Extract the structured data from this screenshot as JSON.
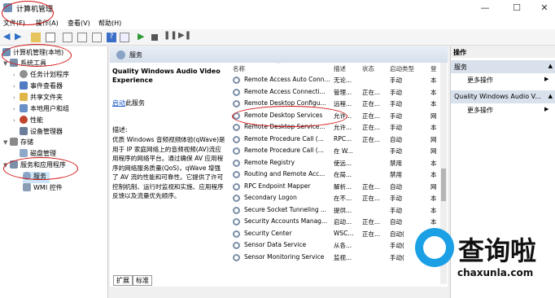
{
  "window": {
    "title": "计算机管理",
    "min_glyph": "—",
    "max_glyph": "☐",
    "close_glyph": "✕"
  },
  "menu": [
    "文件(F)",
    "操作(A)",
    "查看(V)",
    "帮助(H)"
  ],
  "tree": [
    {
      "label": "计算机管理(本地)",
      "icon": "computer-icon",
      "color": "#6f8fb3",
      "arrow": ""
    },
    {
      "label": "系统工具",
      "icon": "tools-icon",
      "color": "#7a8fa8",
      "arrow": "▼"
    },
    {
      "label": "任务计划程序",
      "icon": "clock-icon",
      "color": "#8f8f8f",
      "arrow": "›"
    },
    {
      "label": "事件查看器",
      "icon": "event-viewer-icon",
      "color": "#4f7cc2",
      "arrow": "›"
    },
    {
      "label": "共享文件夹",
      "icon": "shared-folder-icon",
      "color": "#e0b64a",
      "arrow": "›"
    },
    {
      "label": "本地用户和组",
      "icon": "users-icon",
      "color": "#6a8fc7",
      "arrow": "›"
    },
    {
      "label": "性能",
      "icon": "performance-icon",
      "color": "#c0452d",
      "arrow": "›"
    },
    {
      "label": "设备管理器",
      "icon": "device-manager-icon",
      "color": "#6a7d9a",
      "arrow": ""
    },
    {
      "label": "存储",
      "icon": "storage-icon",
      "color": "#8a8a8a",
      "arrow": "▼"
    },
    {
      "label": "磁盘管理",
      "icon": "disk-icon",
      "color": "#8fa9c9",
      "arrow": ""
    },
    {
      "label": "服务和应用程序",
      "icon": "services-apps-icon",
      "color": "#7c8fa8",
      "arrow": "▼"
    },
    {
      "label": "服务",
      "icon": "services-icon",
      "color": "#8aa3c4",
      "arrow": ""
    },
    {
      "label": "WMI 控件",
      "icon": "wmi-icon",
      "color": "#8a9db5",
      "arrow": ""
    }
  ],
  "center": {
    "header": "服务",
    "selected_service_name": "Quality Windows Audio Video Experience",
    "start_link": "启动",
    "start_suffix": "此服务",
    "desc_label": "描述:",
    "desc_text": "优质 Windows 音频视频体验(qWave)是用于 IP 家庭网络上的音频视频(AV)流应用程序的网络平台。通过确保 AV 应用程序的网络服务质量(QoS)，qWave 增强了 AV 流的性能和可靠性。它提供了许可控制机制、运行时监视和实施、应用程序反馈以及流量优先顺序。",
    "columns": {
      "name": "名称",
      "desc": "描述",
      "status": "状态",
      "startup": "启动类型",
      "logon": "登"
    },
    "services": [
      {
        "name": "Remote Access Auto Conn...",
        "desc": "无论...",
        "status": "",
        "startup": "手动",
        "logon": "本"
      },
      {
        "name": "Remote Access Connecti...",
        "desc": "管理...",
        "status": "正在...",
        "startup": "手动",
        "logon": "本"
      },
      {
        "name": "Remote Desktop Configu...",
        "desc": "远程...",
        "status": "正在...",
        "startup": "手动",
        "logon": "本"
      },
      {
        "name": "Remote Desktop Services",
        "desc": "允许...",
        "status": "正在...",
        "startup": "手动",
        "logon": "网"
      },
      {
        "name": "Remote Desktop Service...",
        "desc": "允许...",
        "status": "正在...",
        "startup": "手动",
        "logon": "本"
      },
      {
        "name": "Remote Procedure Call (...",
        "desc": "RPC...",
        "status": "正在...",
        "startup": "自动",
        "logon": "网"
      },
      {
        "name": "Remote Procedure Call (...",
        "desc": "在 W...",
        "status": "",
        "startup": "手动",
        "logon": "网"
      },
      {
        "name": "Remote Registry",
        "desc": "使远...",
        "status": "",
        "startup": "禁用",
        "logon": "本"
      },
      {
        "name": "Routing and Remote Acc...",
        "desc": "在局...",
        "status": "",
        "startup": "禁用",
        "logon": "本"
      },
      {
        "name": "RPC Endpoint Mapper",
        "desc": "解析...",
        "status": "正在...",
        "startup": "自动",
        "logon": "网"
      },
      {
        "name": "Secondary Logon",
        "desc": "在不...",
        "status": "正在...",
        "startup": "手动",
        "logon": "本"
      },
      {
        "name": "Secure Socket Tunneling ...",
        "desc": "提供...",
        "status": "",
        "startup": "手动",
        "logon": "本"
      },
      {
        "name": "Security Accounts Manag...",
        "desc": "启动...",
        "status": "正在...",
        "startup": "自动",
        "logon": "本"
      },
      {
        "name": "Security Center",
        "desc": "WSC...",
        "status": "正在...",
        "startup": "自动(",
        "logon": "本"
      },
      {
        "name": "Sensor Data Service",
        "desc": "从各...",
        "status": "",
        "startup": "手动(",
        "logon": "本"
      },
      {
        "name": "Sensor Monitoring Service",
        "desc": "监视...",
        "status": "",
        "startup": "手动(",
        "logon": "本"
      }
    ],
    "tabs": [
      "扩展",
      "标准"
    ]
  },
  "actions": {
    "header": "操作",
    "section1": "服务",
    "more1": "更多操作",
    "section2": "Quality Windows Audio V...",
    "more2": "更多操作"
  },
  "watermark": {
    "text": "查询啦",
    "url": "chaxunla.com"
  },
  "colors": {
    "accent": "#1ba0e6",
    "annotation": "#d01010",
    "link": "#1a57c8"
  }
}
